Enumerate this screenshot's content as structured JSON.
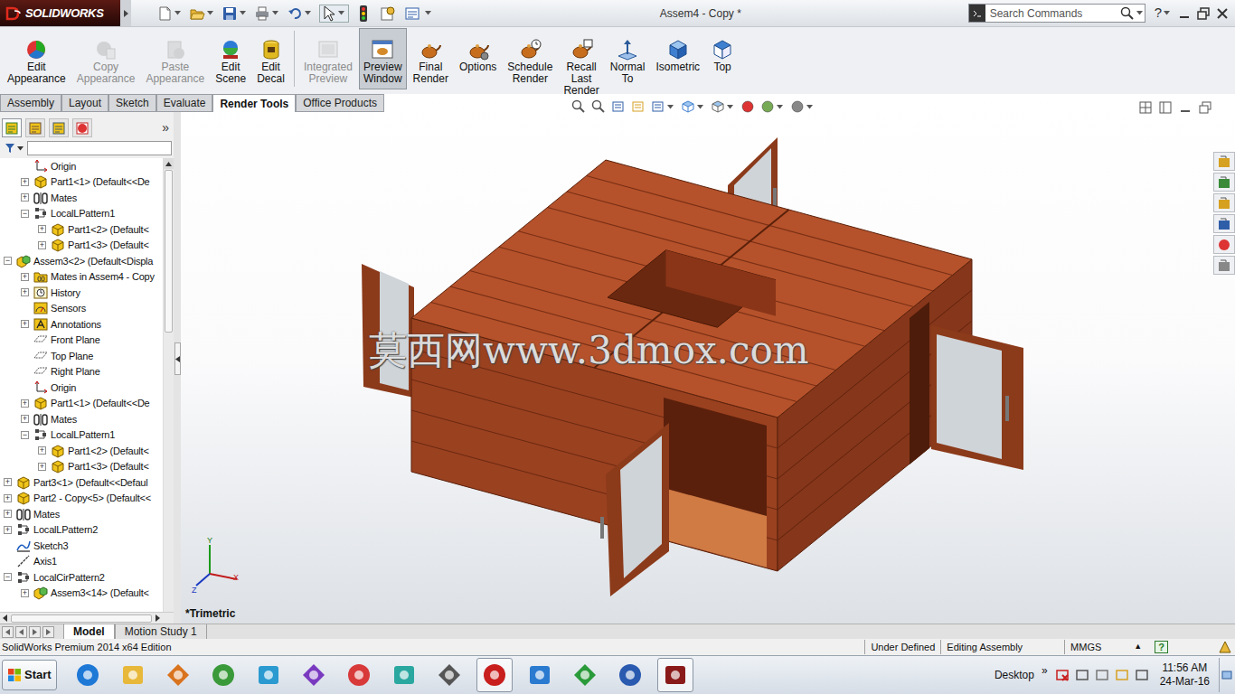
{
  "window": {
    "title": "Assem4 - Copy *",
    "logo": "SOLIDWORKS",
    "help": "?"
  },
  "search": {
    "placeholder": "Search Commands"
  },
  "ribbon": {
    "buttons": [
      {
        "lines": [
          "Edit",
          "Appearance"
        ],
        "disabled": false,
        "selected": false
      },
      {
        "lines": [
          "Copy",
          "Appearance"
        ],
        "disabled": true,
        "selected": false
      },
      {
        "lines": [
          "Paste",
          "Appearance"
        ],
        "disabled": true,
        "selected": false
      },
      {
        "lines": [
          "Edit",
          "Scene"
        ],
        "disabled": false,
        "selected": false
      },
      {
        "lines": [
          "Edit",
          "Decal"
        ],
        "disabled": false,
        "selected": false
      },
      {
        "lines": [
          "Integrated",
          "Preview"
        ],
        "disabled": true,
        "selected": false
      },
      {
        "lines": [
          "Preview",
          "Window"
        ],
        "disabled": false,
        "selected": true
      },
      {
        "lines": [
          "Final",
          "Render"
        ],
        "disabled": false,
        "selected": false
      },
      {
        "lines": [
          "Options"
        ],
        "disabled": false,
        "selected": false
      },
      {
        "lines": [
          "Schedule",
          "Render"
        ],
        "disabled": false,
        "selected": false
      },
      {
        "lines": [
          "Recall",
          "Last",
          "Render"
        ],
        "disabled": false,
        "selected": false
      },
      {
        "lines": [
          "Normal",
          "To"
        ],
        "disabled": false,
        "selected": false
      },
      {
        "lines": [
          "Isometric"
        ],
        "disabled": false,
        "selected": false
      },
      {
        "lines": [
          "Top"
        ],
        "disabled": false,
        "selected": false
      }
    ]
  },
  "tabs": [
    {
      "label": "Assembly",
      "selected": false
    },
    {
      "label": "Layout",
      "selected": false
    },
    {
      "label": "Sketch",
      "selected": false
    },
    {
      "label": "Evaluate",
      "selected": false
    },
    {
      "label": "Render Tools",
      "selected": true
    },
    {
      "label": "Office Products",
      "selected": false
    }
  ],
  "panel": {
    "more": "»"
  },
  "tree": {
    "items": [
      {
        "label": "Origin",
        "level": 1,
        "toggle": "",
        "kind": "origin"
      },
      {
        "label": "Part1<1> (Default<<De",
        "level": 1,
        "toggle": "+",
        "kind": "part"
      },
      {
        "label": "Mates",
        "level": 1,
        "toggle": "+",
        "kind": "mates"
      },
      {
        "label": "LocalLPattern1",
        "level": 1,
        "toggle": "−",
        "kind": "pattern"
      },
      {
        "label": "Part1<2> (Default<",
        "level": 2,
        "toggle": "+",
        "kind": "part"
      },
      {
        "label": "Part1<3> (Default<",
        "level": 2,
        "toggle": "+",
        "kind": "part"
      },
      {
        "label": "Assem3<2> (Default<Displa",
        "level": 0,
        "toggle": "−",
        "kind": "assembly"
      },
      {
        "label": "Mates in Assem4 - Copy",
        "level": 1,
        "toggle": "+",
        "kind": "mates-folder"
      },
      {
        "label": "History",
        "level": 1,
        "toggle": "+",
        "kind": "history"
      },
      {
        "label": "Sensors",
        "level": 1,
        "toggle": "",
        "kind": "sensors"
      },
      {
        "label": "Annotations",
        "level": 1,
        "toggle": "+",
        "kind": "annotations"
      },
      {
        "label": "Front Plane",
        "level": 1,
        "toggle": "",
        "kind": "plane"
      },
      {
        "label": "Top Plane",
        "level": 1,
        "toggle": "",
        "kind": "plane"
      },
      {
        "label": "Right Plane",
        "level": 1,
        "toggle": "",
        "kind": "plane"
      },
      {
        "label": "Origin",
        "level": 1,
        "toggle": "",
        "kind": "origin"
      },
      {
        "label": "Part1<1> (Default<<De",
        "level": 1,
        "toggle": "+",
        "kind": "part"
      },
      {
        "label": "Mates",
        "level": 1,
        "toggle": "+",
        "kind": "mates"
      },
      {
        "label": "LocalLPattern1",
        "level": 1,
        "toggle": "−",
        "kind": "pattern"
      },
      {
        "label": "Part1<2> (Default<",
        "level": 2,
        "toggle": "+",
        "kind": "part"
      },
      {
        "label": "Part1<3> (Default<",
        "level": 2,
        "toggle": "+",
        "kind": "part"
      },
      {
        "label": "Part3<1> (Default<<Defaul",
        "level": 0,
        "toggle": "+",
        "kind": "part"
      },
      {
        "label": "Part2 - Copy<5> (Default<<",
        "level": 0,
        "toggle": "+",
        "kind": "part"
      },
      {
        "label": "Mates",
        "level": 0,
        "toggle": "+",
        "kind": "mates"
      },
      {
        "label": "LocalLPattern2",
        "level": 0,
        "toggle": "+",
        "kind": "pattern"
      },
      {
        "label": "Sketch3",
        "level": 0,
        "toggle": "",
        "kind": "sketch"
      },
      {
        "label": "Axis1",
        "level": 0,
        "toggle": "",
        "kind": "axis"
      },
      {
        "label": "LocalCirPattern2",
        "level": 0,
        "toggle": "−",
        "kind": "pattern"
      },
      {
        "label": "Assem3<14> (Default<",
        "level": 1,
        "toggle": "+",
        "kind": "assembly"
      }
    ]
  },
  "viewport": {
    "watermark": "莫西网www.3dmox.com",
    "view_label": "*Trimetric",
    "axes": {
      "x": "X",
      "y": "Y",
      "z": "Z"
    }
  },
  "bottom_tabs": [
    {
      "label": "Model",
      "selected": true
    },
    {
      "label": "Motion Study 1",
      "selected": false
    }
  ],
  "status_bar": {
    "product": "SolidWorks Premium 2014 x64 Edition",
    "fields": [
      "Under Defined",
      "Editing Assembly"
    ],
    "units": "MMGS",
    "units_arrow": "▲",
    "help": "?"
  },
  "taskbar": {
    "start": "Start",
    "desktop": "Desktop",
    "chevron": "»",
    "time": "11:56 AM",
    "date": "24-Mar-16"
  }
}
